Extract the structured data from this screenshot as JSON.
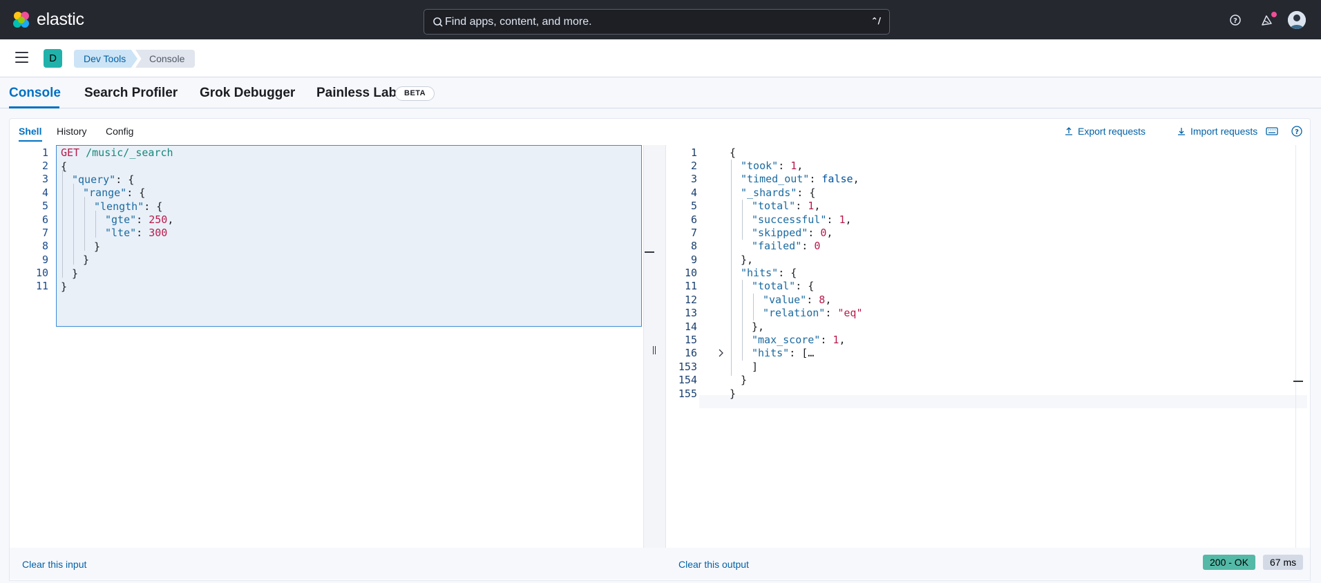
{
  "header": {
    "brand": "elastic",
    "search_placeholder": "Find apps, content, and more.",
    "search_shortcut": "⌃/"
  },
  "breadcrumbs": {
    "space_initial": "D",
    "items": [
      "Dev Tools",
      "Console"
    ]
  },
  "main_tabs": {
    "items": [
      "Console",
      "Search Profiler",
      "Grok Debugger",
      "Painless Lab"
    ],
    "badge": "BETA",
    "active": "Console"
  },
  "sub_tabs": {
    "items": [
      "Shell",
      "History",
      "Config"
    ],
    "active": "Shell"
  },
  "actions": {
    "export": "Export requests",
    "import": "Import requests"
  },
  "request_editor": {
    "line_numbers": [
      "1",
      "2",
      "3",
      "4",
      "5",
      "6",
      "7",
      "8",
      "9",
      "10",
      "11"
    ],
    "method": "GET",
    "path": "/music/_search",
    "field_query": "\"query\"",
    "field_range": "\"range\"",
    "field_length": "\"length\"",
    "field_gte": "\"gte\"",
    "gte_value": "250",
    "field_lte": "\"lte\"",
    "lte_value": "300"
  },
  "response_editor": {
    "line_numbers": [
      "1",
      "2",
      "3",
      "4",
      "5",
      "6",
      "7",
      "8",
      "9",
      "10",
      "11",
      "12",
      "13",
      "14",
      "15",
      "16",
      "153",
      "154",
      "155"
    ],
    "took": "1",
    "timed_out": "false",
    "shards_total": "1",
    "shards_successful": "1",
    "shards_skipped": "0",
    "shards_failed": "0",
    "hits_total_value": "8",
    "hits_total_relation": "\"eq\"",
    "max_score": "1",
    "folded": "[…"
  },
  "footer": {
    "clear_input": "Clear this input",
    "clear_output": "Clear this output",
    "status": "200 - OK",
    "time": "67 ms"
  },
  "colors": {
    "accent": "#0071c2",
    "header_bg": "#25282f",
    "status_ok": "#54b9a7",
    "string": "#b9194a",
    "key": "#1a6aa0"
  }
}
